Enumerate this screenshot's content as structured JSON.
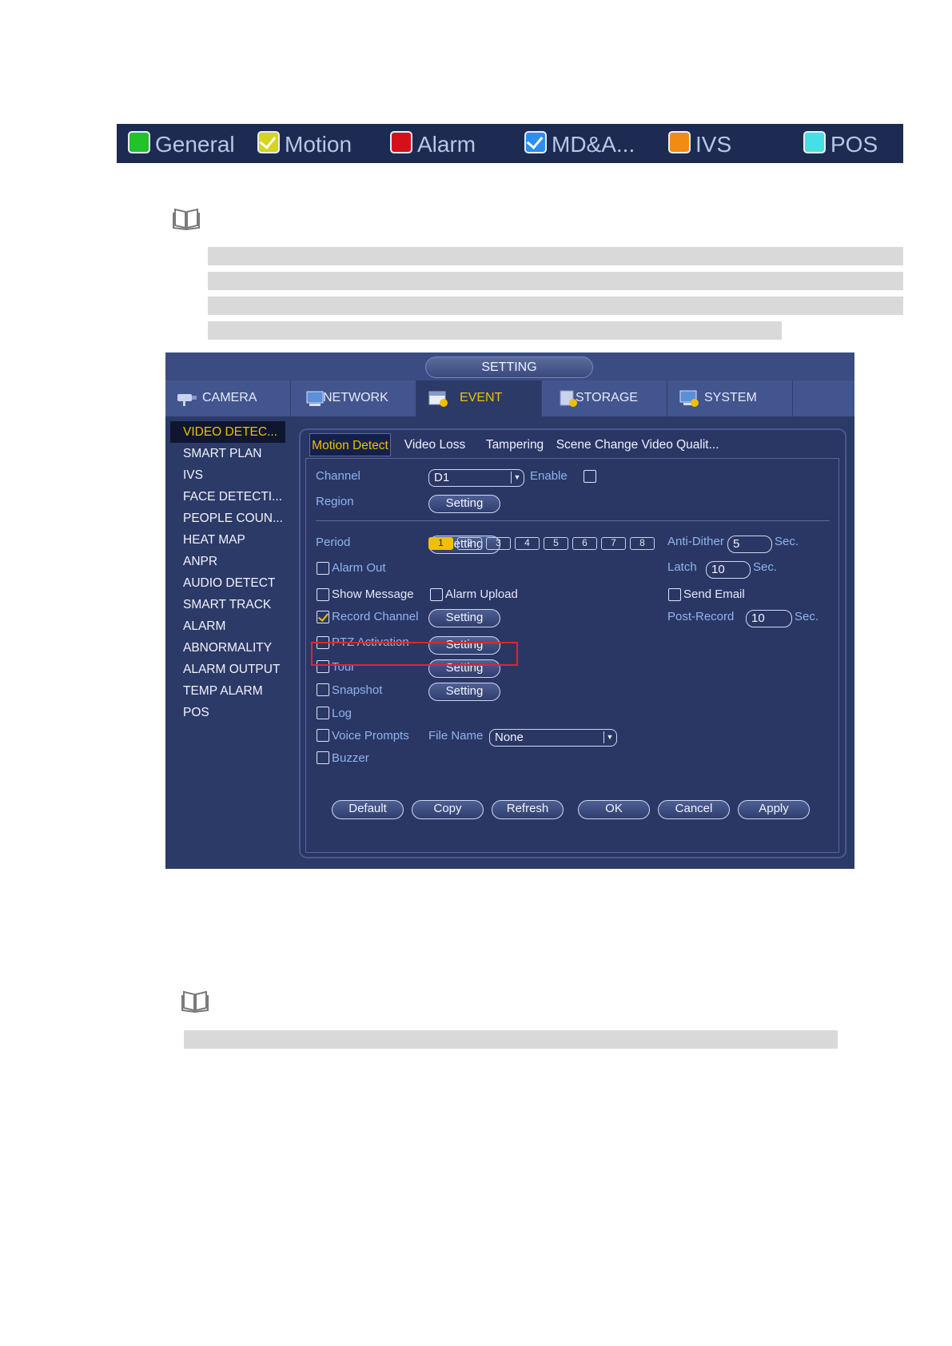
{
  "legend": [
    {
      "label": "General",
      "color": "#22c22a",
      "checked": false
    },
    {
      "label": "Motion",
      "color": "#d6d41c",
      "checked": true
    },
    {
      "label": "Alarm",
      "color": "#d4111b",
      "checked": false
    },
    {
      "label": "MD&A...",
      "color": "#2b8ef0",
      "checked": true
    },
    {
      "label": "IVS",
      "color": "#f08c14",
      "checked": false
    },
    {
      "label": "POS",
      "color": "#44e0e6",
      "checked": false
    }
  ],
  "window": {
    "title": "SETTING",
    "main_tabs": [
      {
        "label": "CAMERA",
        "icon": "camera-icon"
      },
      {
        "label": "NETWORK",
        "icon": "network-icon"
      },
      {
        "label": "EVENT",
        "icon": "event-icon"
      },
      {
        "label": "STORAGE",
        "icon": "storage-icon"
      },
      {
        "label": "SYSTEM",
        "icon": "system-icon"
      }
    ],
    "active_main_tab": "EVENT",
    "sidebar": [
      "VIDEO DETEC...",
      "SMART PLAN",
      "IVS",
      "FACE DETECTI...",
      "PEOPLE COUN...",
      "HEAT MAP",
      "ANPR",
      "AUDIO DETECT",
      "SMART TRACK",
      "ALARM",
      "ABNORMALITY",
      "ALARM OUTPUT",
      "TEMP ALARM",
      "POS"
    ],
    "sub_tabs": [
      "Motion Detect",
      "Video Loss",
      "Tampering",
      "Scene Change",
      "Video Qualit..."
    ],
    "form": {
      "channel_label": "Channel",
      "channel_value": "D1",
      "enable_label": "Enable",
      "region_label": "Region",
      "setting_label": "Setting",
      "period_label": "Period",
      "anti_dither_label": "Anti-Dither",
      "anti_dither_value": "5",
      "sec_label": "Sec.",
      "alarm_out_label": "Alarm Out",
      "alarm_channels": [
        "1",
        "2",
        "3",
        "4",
        "5",
        "6",
        "7",
        "8"
      ],
      "latch_label": "Latch",
      "latch_value": "10",
      "show_message_label": "Show Message",
      "alarm_upload_label": "Alarm Upload",
      "send_email_label": "Send Email",
      "record_channel_label": "Record Channel",
      "post_record_label": "Post-Record",
      "post_record_value": "10",
      "ptz_activation_label": "PTZ Activation",
      "tour_label": "Tour",
      "snapshot_label": "Snapshot",
      "log_label": "Log",
      "voice_prompts_label": "Voice Prompts",
      "file_name_label": "File Name",
      "file_name_value": "None",
      "buzzer_label": "Buzzer"
    },
    "buttons": [
      "Default",
      "Copy",
      "Refresh",
      "OK",
      "Cancel",
      "Apply"
    ],
    "highlight_color": "#e2242c",
    "accent_color": "#f0c000"
  }
}
